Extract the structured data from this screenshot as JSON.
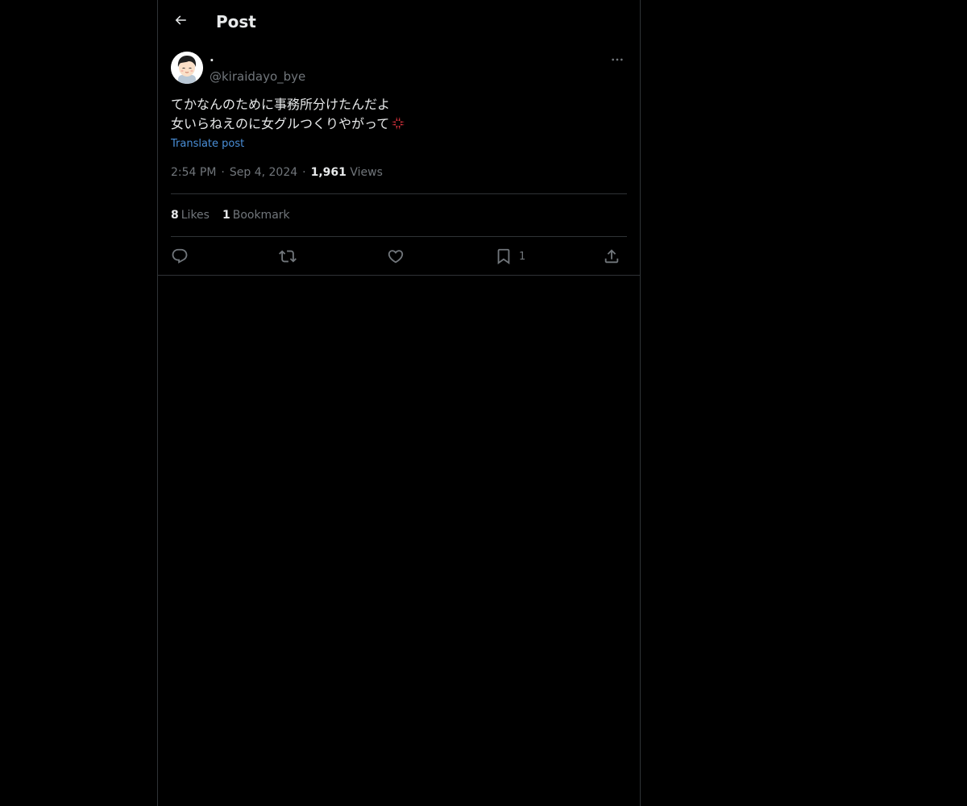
{
  "header": {
    "title": "Post",
    "back_icon": "arrow-left-icon"
  },
  "author": {
    "display_name": "·",
    "handle": "@kiraidayo_bye",
    "avatar_icon": "cartoon-avatar-icon",
    "more_icon": "more-horizontal-icon"
  },
  "post": {
    "line1": "てかなんのために事務所分けたんだよ",
    "line2": "女いらねえのに女グルつくりやがって",
    "emoji": "anger-symbol-icon",
    "translate_label": "Translate post"
  },
  "meta": {
    "time": "2:54 PM",
    "sep1": "·",
    "date": "Sep 4, 2024",
    "sep2": "·",
    "views_count": "1,961",
    "views_label": "Views"
  },
  "stats": {
    "likes_count": "8",
    "likes_label": "Likes",
    "bookmarks_count": "1",
    "bookmarks_label": "Bookmark"
  },
  "actions": {
    "reply_icon": "reply-icon",
    "repost_icon": "repost-icon",
    "like_icon": "heart-icon",
    "bookmark_icon": "bookmark-icon",
    "bookmark_count": "1",
    "share_icon": "share-icon"
  },
  "colors": {
    "background": "#000000",
    "text": "#e7e9ea",
    "muted": "#71767b",
    "border": "#2f3336",
    "link": "#4a8fd8",
    "emoji_red": "#d5323c"
  }
}
